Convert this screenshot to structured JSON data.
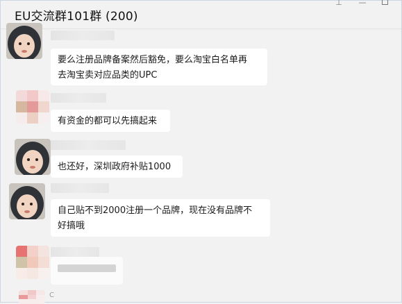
{
  "window": {
    "title": "EU交流群101群 (200)",
    "controls": [
      "pin-icon",
      "minimize-icon",
      "maximize-icon"
    ],
    "pin_glyph": "⊥",
    "minimize_glyph": "—"
  },
  "messages": [
    {
      "sender": "",
      "avatar": "child-hood-photo",
      "lines": [
        "要么注册品牌备案然后豁免，要么淘宝白名单再",
        "去淘宝卖对应品类的UPC"
      ]
    },
    {
      "sender": "",
      "avatar": "pixelated-photo",
      "lines": [
        "有资金的都可以先搞起来"
      ]
    },
    {
      "sender": "",
      "avatar": "child-hood-photo",
      "lines": [
        "也还好，深圳政府补贴1000"
      ]
    },
    {
      "sender": "",
      "avatar": "child-hood-photo",
      "lines": [
        "自己贴不到2000注册一个品牌，现在没有品牌不",
        "好搞哦"
      ]
    },
    {
      "sender": "",
      "avatar": "pixelated-photo",
      "lines": []
    },
    {
      "sender": "",
      "avatar": "pixelated-photo",
      "lines": [],
      "partial_text": "C"
    }
  ],
  "colors": {
    "background": "#f2f2f2",
    "bubble": "#ffffff",
    "text": "#1a1a1a"
  }
}
